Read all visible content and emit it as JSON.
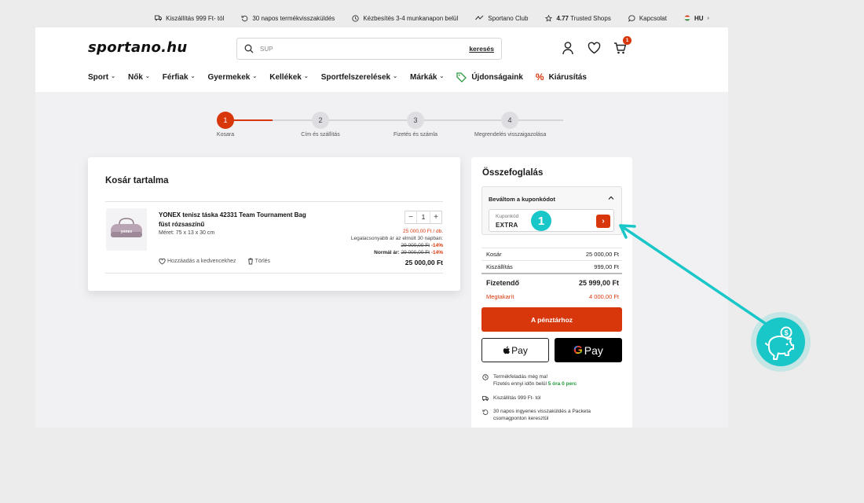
{
  "topbar": {
    "items": [
      {
        "icon": "truck-icon",
        "text": "Kiszállítás 999 Ft- tól",
        "bold": ""
      },
      {
        "icon": "return-icon",
        "text": "30 napos termékvisszaküldés",
        "bold": ""
      },
      {
        "icon": "clock-icon",
        "text": "Kézbesítés 3-4 munkanapon belül",
        "bold": ""
      },
      {
        "icon": "club-icon",
        "text": "Sportano Club",
        "bold": ""
      },
      {
        "icon": "star-icon",
        "text": " Trusted Shops",
        "bold": "4.77"
      },
      {
        "icon": "chat-icon",
        "text": "Kapcsolat",
        "bold": ""
      },
      {
        "icon": "flag-hu-icon",
        "text": "HU",
        "bold": ""
      }
    ]
  },
  "header": {
    "logo": "sportano.hu",
    "search": {
      "placeholder": "SUP",
      "button": "keresés"
    },
    "cart_count": "1"
  },
  "nav": {
    "items": [
      {
        "label": "Sport",
        "dropdown": true
      },
      {
        "label": "Nők",
        "dropdown": true
      },
      {
        "label": "Férfiak",
        "dropdown": true
      },
      {
        "label": "Gyermekek",
        "dropdown": true
      },
      {
        "label": "Kellékek",
        "dropdown": true
      },
      {
        "label": "Sportfelszerelések",
        "dropdown": true
      },
      {
        "label": "Márkák",
        "dropdown": true
      }
    ],
    "new": "Újdonságaink",
    "sale": "Kiárusítás"
  },
  "steps": [
    {
      "num": "1",
      "label": "Kosara",
      "active": true
    },
    {
      "num": "2",
      "label": "Cím és szállítás",
      "active": false
    },
    {
      "num": "3",
      "label": "Fizetés és számla",
      "active": false
    },
    {
      "num": "4",
      "label": "Megrendelés visszaigazolása",
      "active": false
    }
  ],
  "cart": {
    "title": "Kosár tartalma",
    "product": {
      "image_text": "yonex",
      "name": "YONEX tenisz táska 42331 Team Tournament Bag füst rózsaszínű",
      "size": "Méret: 75 x 13 x 30 cm",
      "qty": "1",
      "unit_price": "25 000,00 Ft / db.",
      "lowest_label": "Legalacsonyabb ár az elmúlt 30 napban:",
      "lowest_old": "29 000,00 Ft",
      "lowest_disc": "-14%",
      "normal_label": "Normál ár:",
      "normal_old": "29 000,00 Ft",
      "normal_disc": "-14%",
      "total": "25 000,00 Ft",
      "fav_label": "Hozzáadás a kedvencekhez",
      "delete_label": "Törlés"
    }
  },
  "summary": {
    "title": "Összefoglalás",
    "coupon": {
      "header": "Beváltom a kuponkódot",
      "field_label": "Kuponkód",
      "value": "EXTRA",
      "badge": "1"
    },
    "rows": {
      "cart_label": "Kosár",
      "cart_value": "25 000,00 Ft",
      "ship_label": "Kiszállítás",
      "ship_value": "999,00 Ft",
      "pay_label": "Fizetendő",
      "pay_value": "25 999,00 Ft",
      "save_label": "Megtakarít",
      "save_value": "4 000,00 Ft"
    },
    "checkout": "A pénztárhoz",
    "apple_pay": "Pay",
    "google_pay": "Pay",
    "info": {
      "dispatch_1": "Termékfeladás még ma!",
      "dispatch_2": "Fizetés ennyi időn belül ",
      "dispatch_time": "5 óra 0 perc",
      "shipping": "Kiszállítás 999 Ft- tól",
      "returns": "30 napos ingyenes visszaküldés a Packeta csomagponton keresztül"
    }
  },
  "colors": {
    "accent": "#d8360b",
    "teal": "#19c6c8",
    "green": "#1f9a39"
  }
}
